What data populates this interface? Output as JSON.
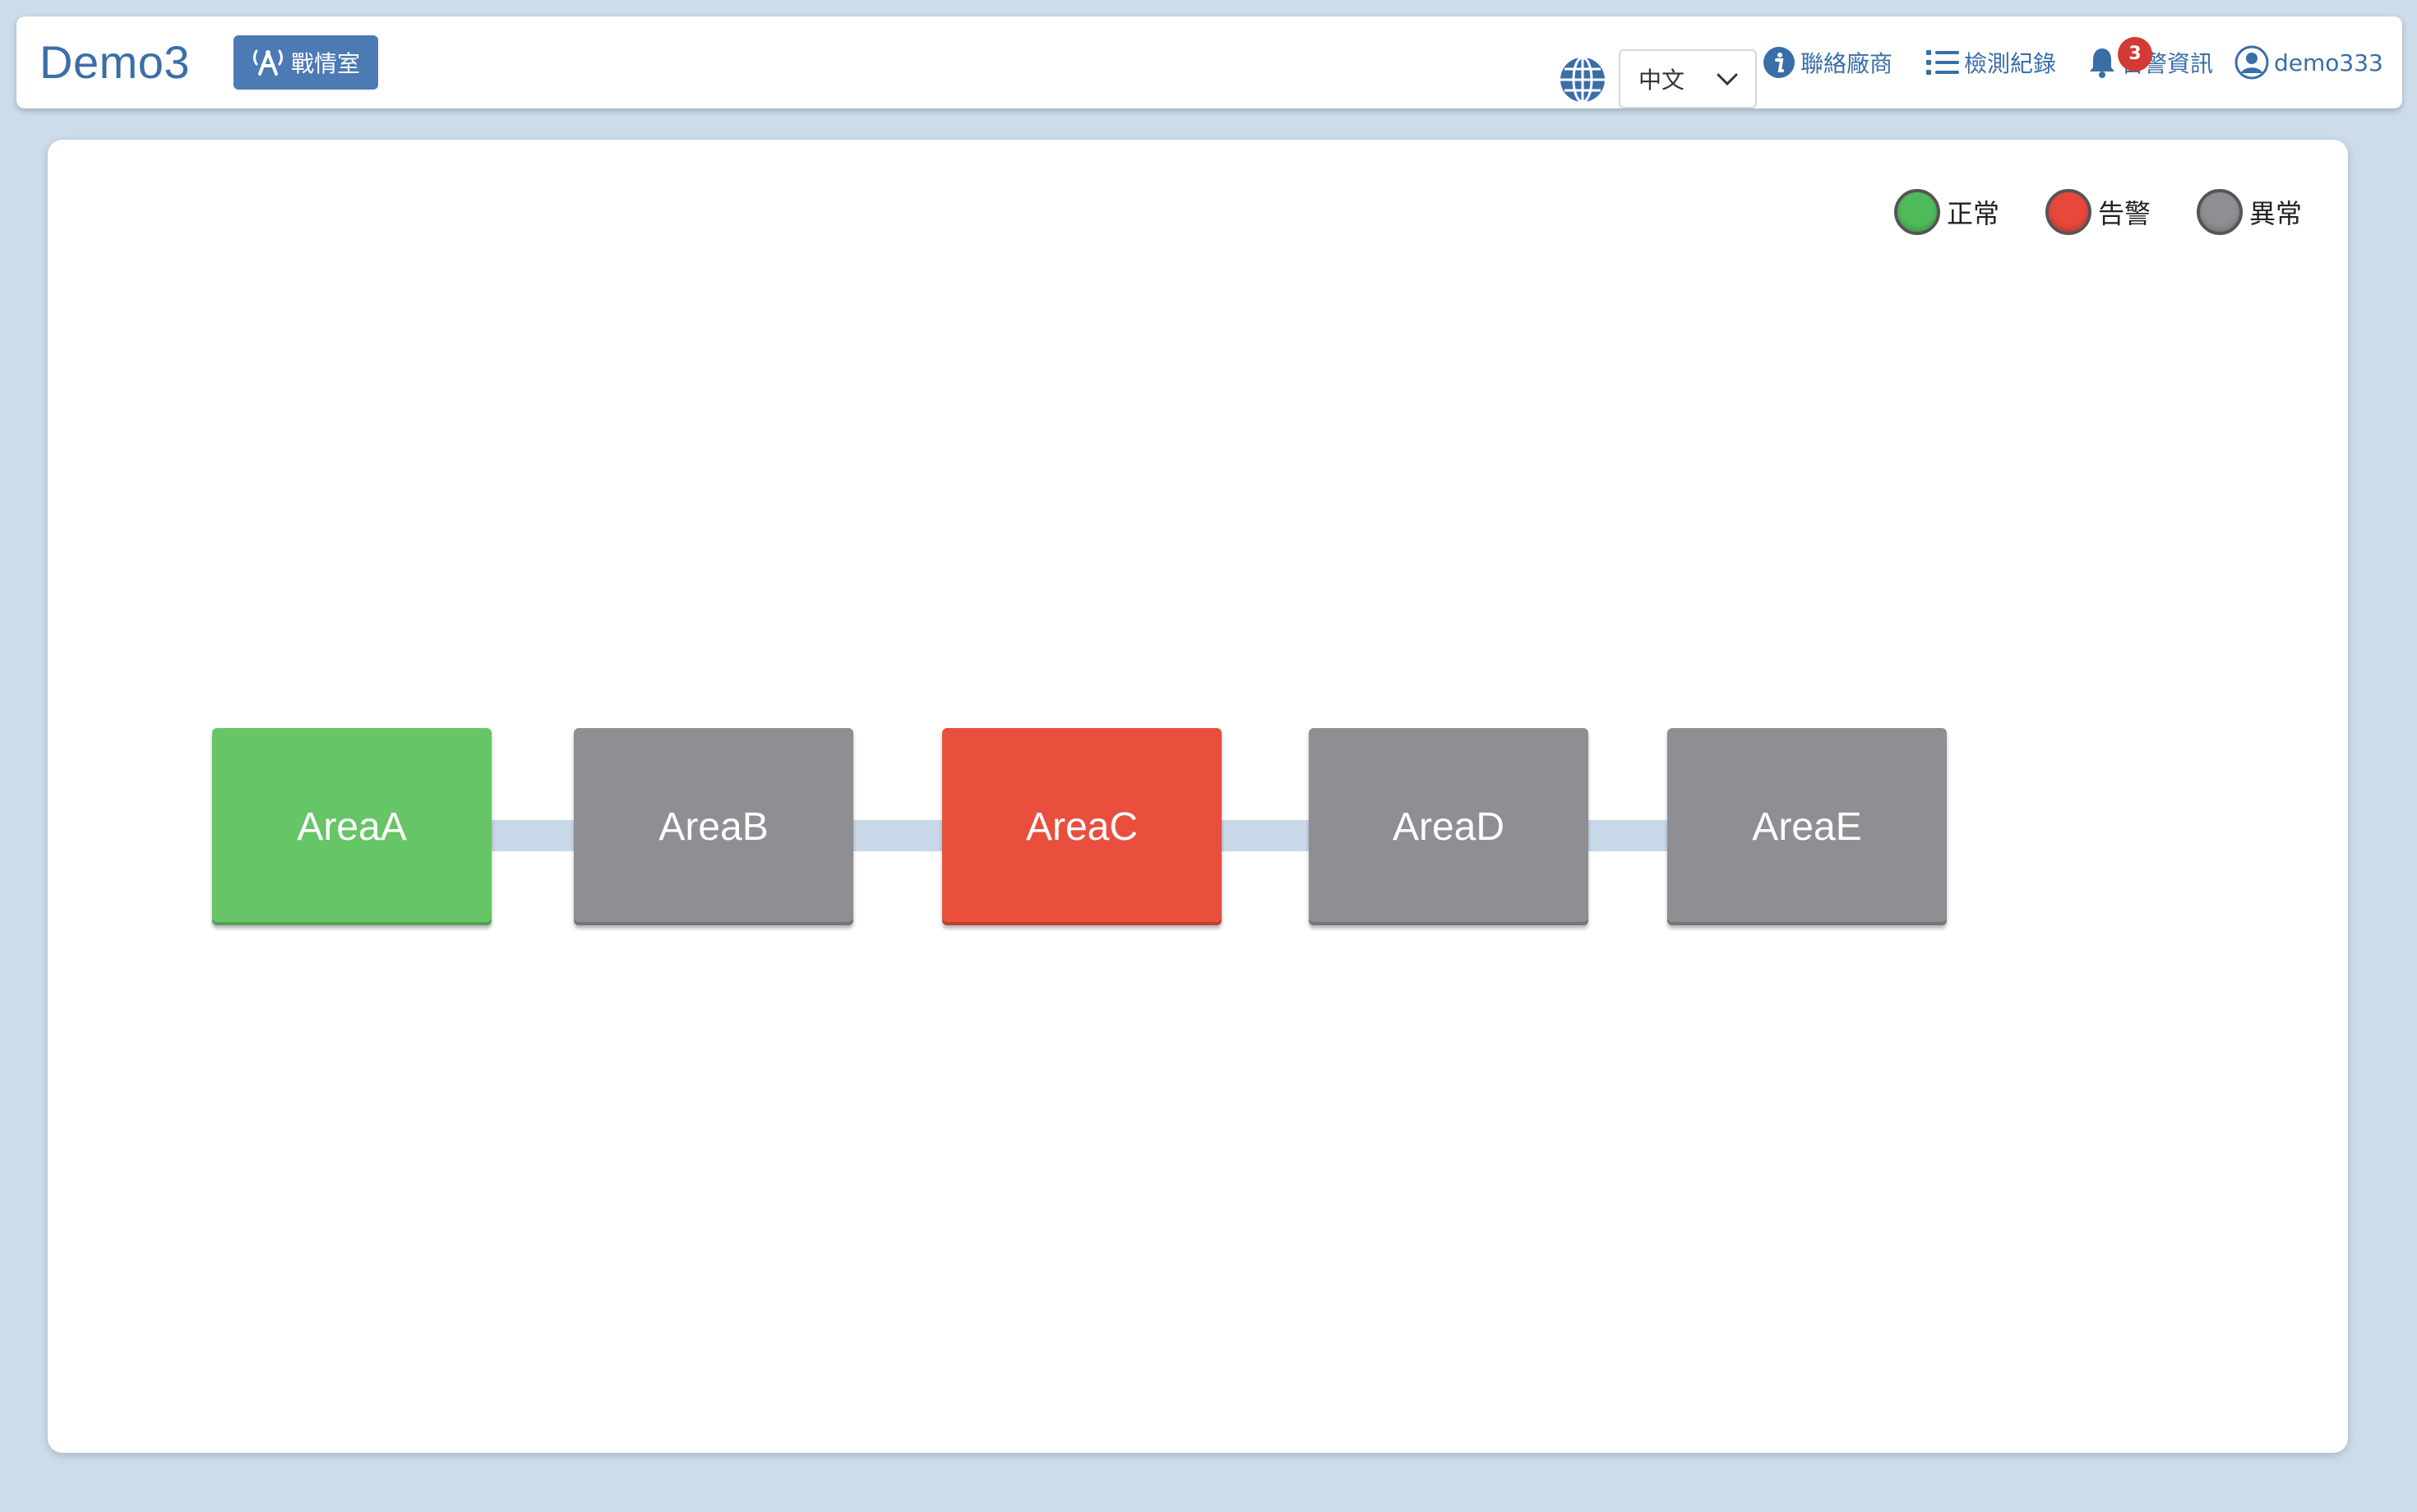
{
  "header": {
    "brand": "Demo3",
    "war_room_label": "戰情室",
    "language": {
      "selected": "中文"
    },
    "nav": {
      "contact_vendor": "聯絡廠商",
      "inspection_log": "檢測紀錄",
      "alert_info": "告警資訊",
      "alert_count": "3",
      "username": "demo333"
    }
  },
  "legend": [
    {
      "label": "正常",
      "color": "#4fba5a"
    },
    {
      "label": "告警",
      "color": "#e8473b"
    },
    {
      "label": "異常",
      "color": "#8e8e93"
    }
  ],
  "areas": [
    {
      "name": "AreaA",
      "status": "正常",
      "color": "#66c566"
    },
    {
      "name": "AreaB",
      "status": "異常",
      "color": "#8e8e93"
    },
    {
      "name": "AreaC",
      "status": "告警",
      "color": "#ea4f3d"
    },
    {
      "name": "AreaD",
      "status": "異常",
      "color": "#8e8e93"
    },
    {
      "name": "AreaE",
      "status": "異常",
      "color": "#8e8e93"
    }
  ],
  "colors": {
    "accent": "#3a6ea8",
    "button": "#4b7ab4",
    "badge": "#d33a35",
    "connector": "#c8d8e8"
  }
}
